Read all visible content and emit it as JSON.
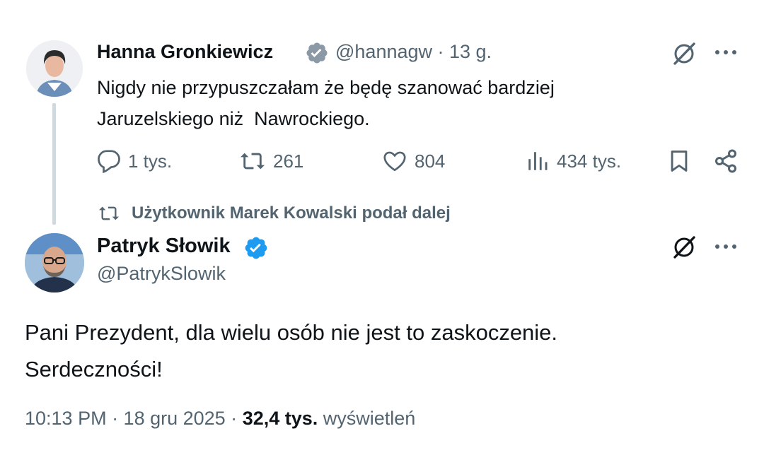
{
  "original_tweet": {
    "author_name": "Hanna Gronkiewicz",
    "verified_badge_color": "#8b98a5",
    "handle_time": "@hannagw · 13 g.",
    "text": "Nigdy nie przypuszczałam że będę szanować bardziej\nJaruzelskiego niż  Nawrockiego.",
    "actions": {
      "replies": "1 tys.",
      "reposts": "261",
      "likes": "804",
      "views": "434 tys."
    }
  },
  "repost_notice": "Użytkownik Marek Kowalski podał dalej",
  "reply_tweet": {
    "author_name": "Patryk Słowik",
    "verified_badge_color": "#1d9bf0",
    "handle": "@PatrykSlowik",
    "text": "Pani Prezydent, dla wielu osób nie jest to zaskoczenie.\nSerdeczności!",
    "footer": {
      "timestamp": "10:13 PM · 18 gru 2025 · ",
      "views_count": "32,4 tys.",
      "views_label": " wyświetleń"
    }
  },
  "icons": [
    "grok-icon",
    "more-icon",
    "reply-icon",
    "retweet-icon",
    "like-icon",
    "views-icon",
    "bookmark-icon",
    "share-icon",
    "verified-badge-icon"
  ]
}
